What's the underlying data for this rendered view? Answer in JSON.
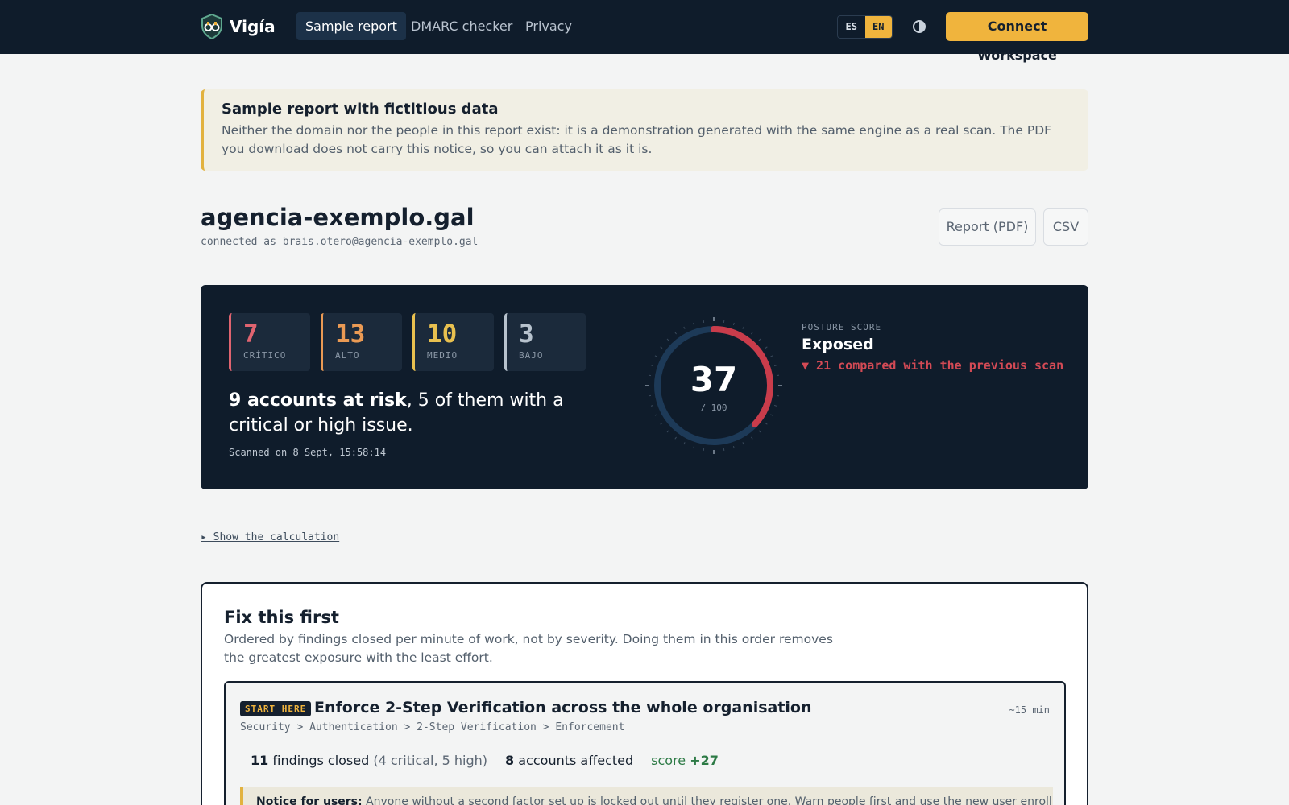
{
  "nav": {
    "brand": "Vigía",
    "links": [
      "Sample report",
      "DMARC checker",
      "Privacy"
    ],
    "active": 0,
    "lang_es": "ES",
    "lang_en": "EN",
    "connect": "Connect Workspace"
  },
  "notice": {
    "title": "Sample report with fictitious data",
    "body": "Neither the domain nor the people in this report exist: it is a demonstration generated with the same engine as a real scan. The PDF you download does not carry this notice, so you can attach it as it is."
  },
  "header": {
    "domain": "agencia-exemplo.gal",
    "connected": "connected as brais.otero@agencia-exemplo.gal",
    "pdf_button": "Report (PDF)",
    "csv_button": "CSV"
  },
  "summary": {
    "severities": [
      {
        "count": "7",
        "label": "CRÍTICO",
        "color": "#e06470"
      },
      {
        "count": "13",
        "label": "ALTO",
        "color": "#ea9a54"
      },
      {
        "count": "10",
        "label": "MEDIO",
        "color": "#e8c04f"
      },
      {
        "count": "3",
        "label": "BAJO",
        "color": "#b7c2cd"
      }
    ],
    "risk_bold": "9 accounts at risk",
    "risk_rest": ", 5 of them with a critical or high issue.",
    "scanned": "Scanned on 8 Sept, 15:58:14",
    "score": "37",
    "score_max": "/ 100",
    "score_value": 37,
    "posture_label": "POSTURE SCORE",
    "posture_status": "Exposed",
    "posture_delta": "▼ 21 compared with the previous scan"
  },
  "calc_link": "▸ Show the calculation",
  "fix": {
    "title": "Fix this first",
    "description": "Ordered by findings closed per minute of work, not by severity. Doing them in this order removes the greatest exposure with the least effort.",
    "task": {
      "badge": "START HERE",
      "title": "Enforce 2-Step Verification across the whole organisation",
      "time": "~15 min",
      "path": "Security > Authentication > 2-Step Verification > Enforcement",
      "findings_count": "11",
      "findings_label": "findings closed",
      "findings_detail": "(4 critical, 5 high)",
      "accounts_count": "8",
      "accounts_label": "accounts affected",
      "score_label": "score",
      "score_delta": "+27",
      "users_notice_bold": "Notice for users:",
      "users_notice": " Anyone without a second factor set up is locked out until they register one. Warn people first and use the new user enrollment period."
    }
  },
  "colors": {
    "accent": "#f0b43d",
    "navy": "#0f1c2b",
    "critical": "#c93c4b"
  }
}
